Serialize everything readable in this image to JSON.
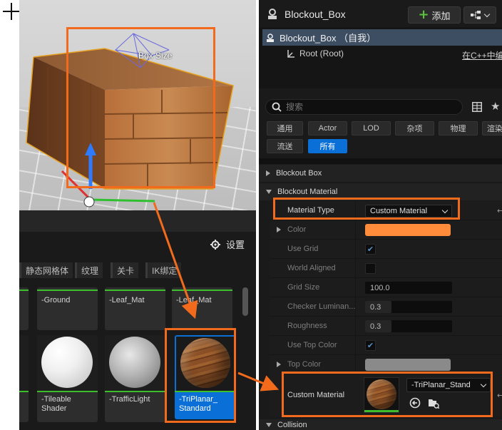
{
  "viewport": {
    "gizmo_label": "Box Size"
  },
  "details": {
    "title": "Blockout_Box",
    "add_button": "添加",
    "tree": {
      "root_item": "Blockout_Box （自我）",
      "child_item": "Root (Root)",
      "edit_link": "在C++中编"
    },
    "search_placeholder": "搜索",
    "filters": {
      "row1": [
        "通用",
        "Actor",
        "LOD",
        "杂项",
        "物理",
        "渲染"
      ],
      "row2": [
        "流送",
        "所有"
      ],
      "active": "所有"
    },
    "categories": {
      "blockout_box": "Blockout Box",
      "blockout_material": "Blockout Material",
      "collision": "Collision"
    },
    "properties": {
      "material_type": {
        "label": "Material Type",
        "value": "Custom Material"
      },
      "color": {
        "label": "Color",
        "color": "#ff8c3a"
      },
      "use_grid": {
        "label": "Use Grid",
        "checked": true
      },
      "world_aligned": {
        "label": "World Aligned",
        "checked": false
      },
      "grid_size": {
        "label": "Grid Size",
        "value": "100.0"
      },
      "checker_luminance": {
        "label": "Checker Luminan...",
        "value": "0.3",
        "fraction": 0.3
      },
      "roughness": {
        "label": "Roughness",
        "value": "0.3",
        "fraction": 0.3
      },
      "use_top_color": {
        "label": "Use Top Color",
        "checked": true
      },
      "top_color": {
        "label": "Top Color",
        "color": "#8a8a8a"
      },
      "custom_material": {
        "label": "Custom Material",
        "value": "-TriPlanar_Stand"
      }
    }
  },
  "browser": {
    "settings_label": "设置",
    "filters": [
      "静态网格体",
      "纹理",
      "关卡",
      "IK绑定"
    ],
    "tiles_row1": [
      "-Ground",
      "-Leaf_Mat",
      "-Leaf_Mat"
    ],
    "tiles_row2": [
      "-Tileable Shader",
      "-TrafficLight",
      "-TriPlanar_ Standard"
    ]
  },
  "colors": {
    "annotation": "#f26b1d",
    "accent_blue": "#0a6fd6",
    "asset_green": "#3dbf2d"
  }
}
